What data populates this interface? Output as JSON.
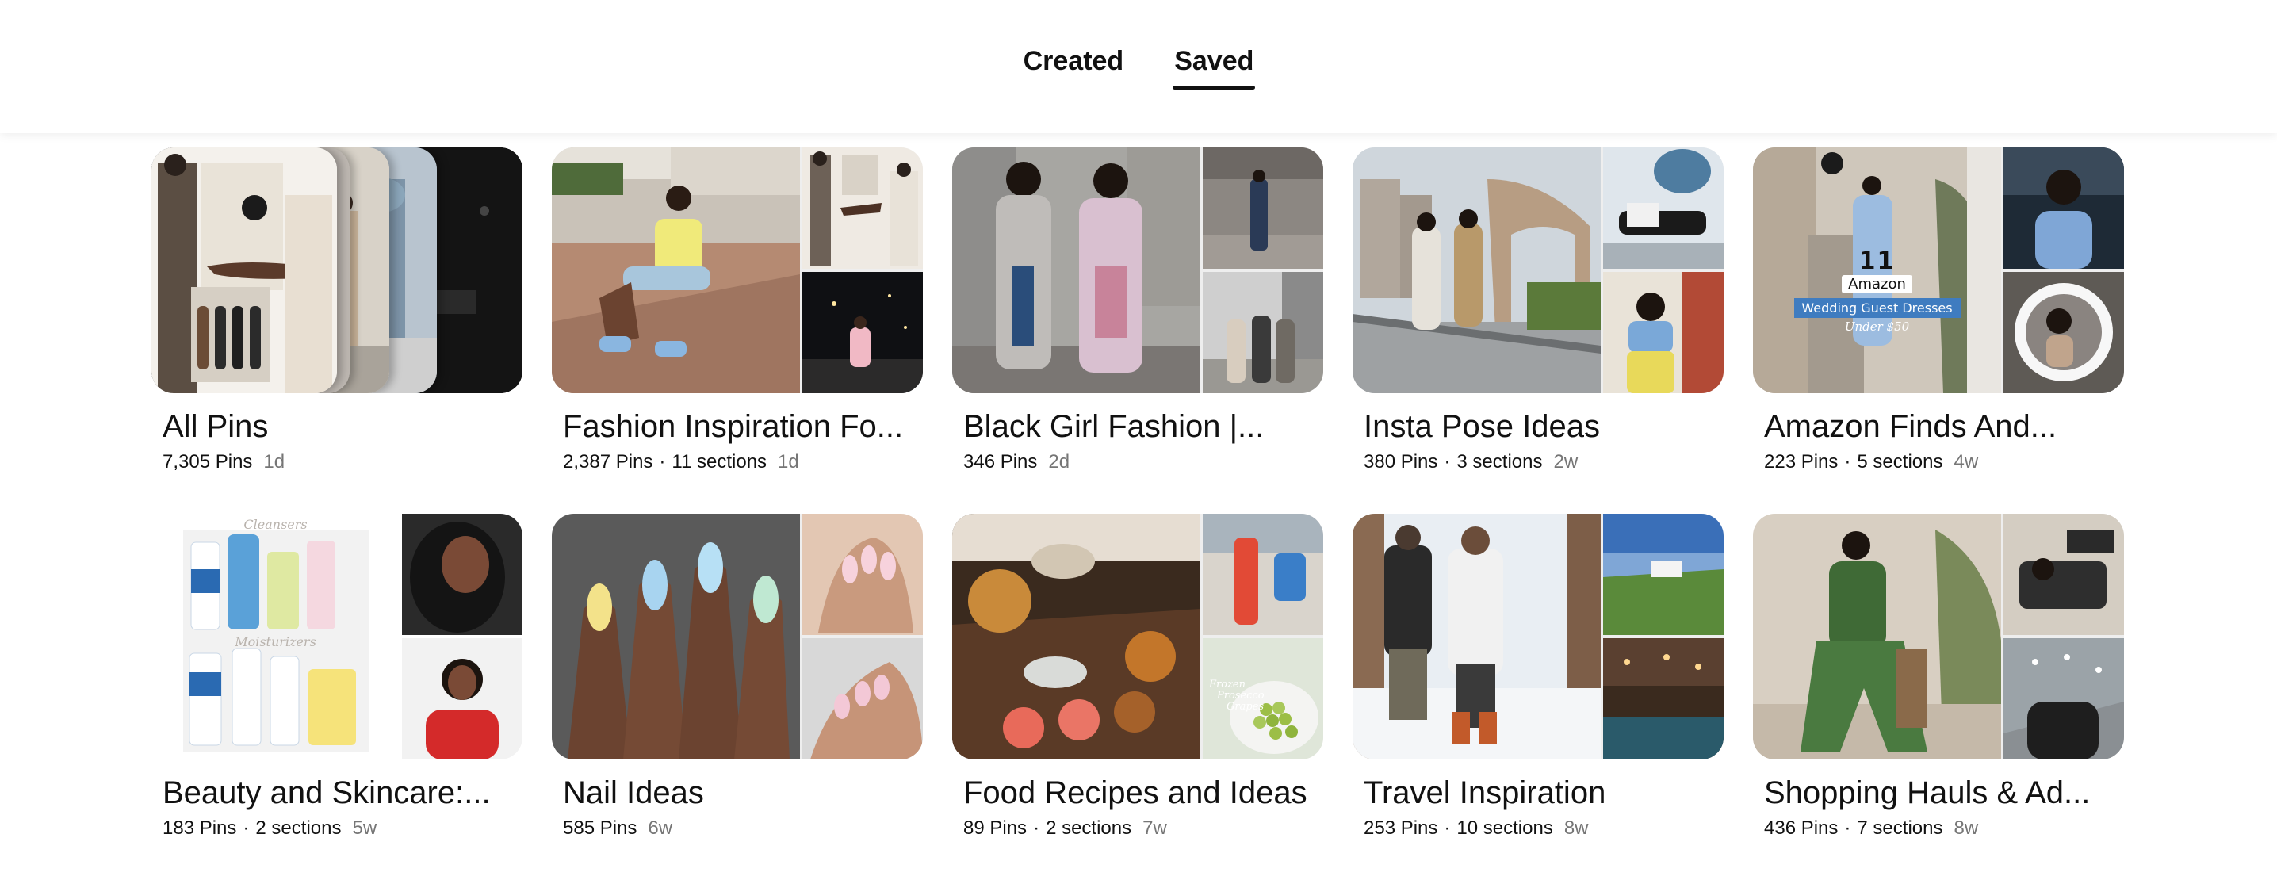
{
  "tabs": [
    {
      "label": "Created",
      "active": false
    },
    {
      "label": "Saved",
      "active": true
    }
  ],
  "boards": [
    {
      "title": "All Pins",
      "pins": "7,305 Pins",
      "sections": "",
      "age": "1d"
    },
    {
      "title": "Fashion Inspiration Fo...",
      "pins": "2,387 Pins",
      "sections": "11 sections",
      "age": "1d"
    },
    {
      "title": "Black Girl Fashion |...",
      "pins": "346 Pins",
      "sections": "",
      "age": "2d"
    },
    {
      "title": "Insta Pose Ideas",
      "pins": "380 Pins",
      "sections": "3 sections",
      "age": "2w"
    },
    {
      "title": "Amazon Finds And...",
      "pins": "223 Pins",
      "sections": "5 sections",
      "age": "4w"
    },
    {
      "title": "Beauty and Skincare:...",
      "pins": "183 Pins",
      "sections": "2 sections",
      "age": "5w"
    },
    {
      "title": "Nail Ideas",
      "pins": "585 Pins",
      "sections": "",
      "age": "6w"
    },
    {
      "title": "Food Recipes and Ideas",
      "pins": "89 Pins",
      "sections": "2 sections",
      "age": "7w"
    },
    {
      "title": "Travel Inspiration",
      "pins": "253 Pins",
      "sections": "10 sections",
      "age": "8w"
    },
    {
      "title": "Shopping Hauls & Ad...",
      "pins": "436 Pins",
      "sections": "7 sections",
      "age": "8w"
    }
  ],
  "cover_text": {
    "amazon_count": "11",
    "amazon_brand": "Amazon",
    "amazon_caption": "Wedding Guest Dresses",
    "amazon_sub": "Under $50",
    "beauty_heading1": "Cleansers",
    "beauty_heading2": "Moisturizers",
    "food_caption1": "Frozen",
    "food_caption2": "Prosecco",
    "food_caption3": "Grapes"
  },
  "colors": {
    "active_underline": "#111111",
    "meta_muted": "#767676"
  }
}
